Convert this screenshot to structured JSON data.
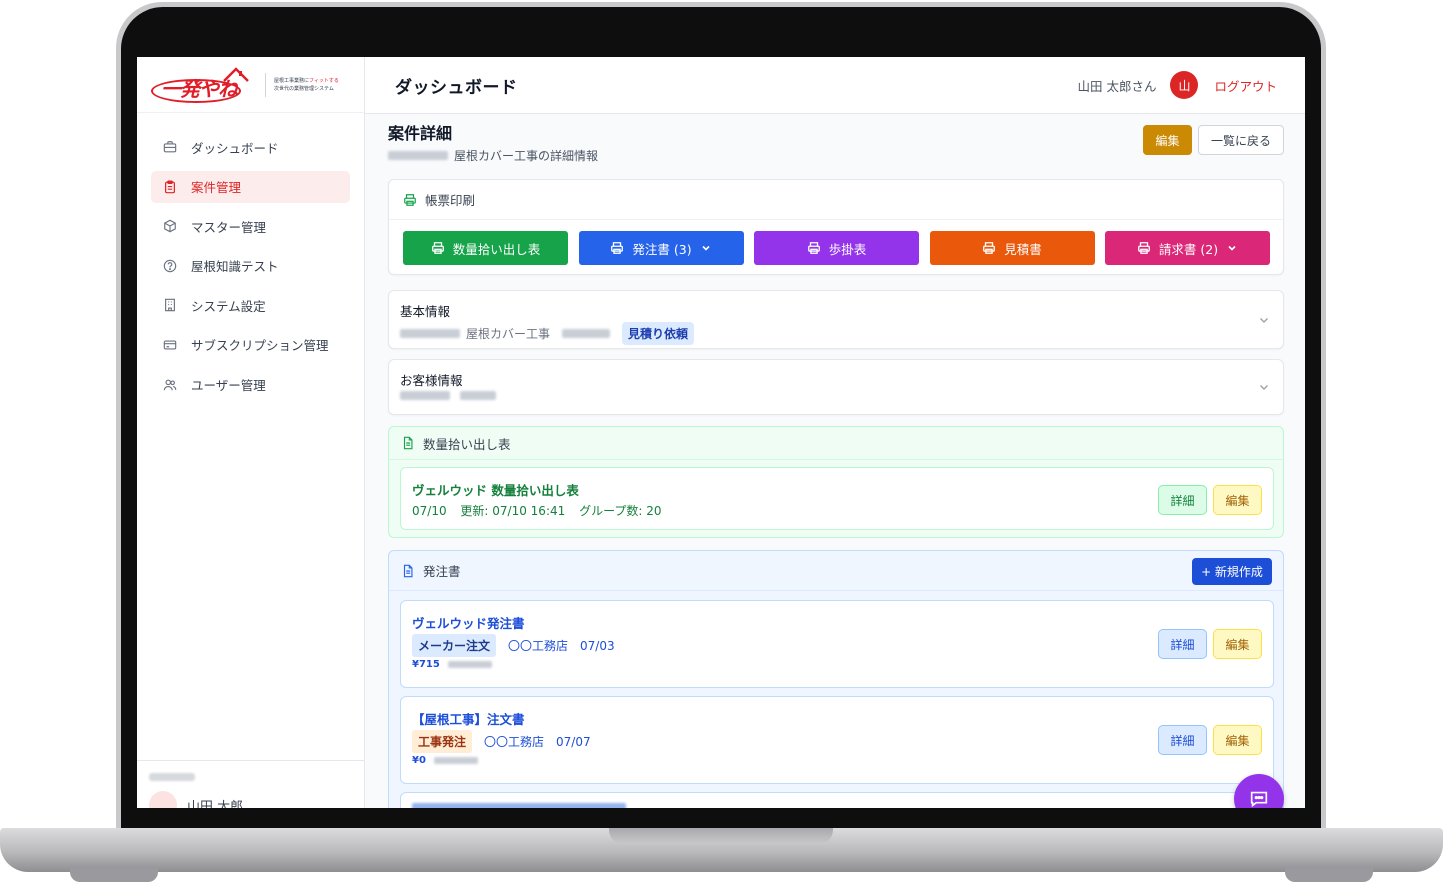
{
  "app": {
    "logo_text": "一発やね",
    "tagline_1": "屋根工事業務に",
    "tagline_hl": "フィットする",
    "tagline_2": "次世代の業務管理システム"
  },
  "header": {
    "page_title": "ダッシュボード",
    "greeting": "山田 太郎さん",
    "avatar_initial": "山",
    "logout_label": "ログアウト"
  },
  "sidebar": {
    "items": [
      {
        "label": "ダッシュボード",
        "icon": "briefcase-icon",
        "active": false
      },
      {
        "label": "案件管理",
        "icon": "clipboard-icon",
        "active": true
      },
      {
        "label": "マスター管理",
        "icon": "cube-icon",
        "active": false
      },
      {
        "label": "屋根知識テスト",
        "icon": "question-circle-icon",
        "active": false
      },
      {
        "label": "システム設定",
        "icon": "building-icon",
        "active": false
      },
      {
        "label": "サブスクリプション管理",
        "icon": "credit-card-icon",
        "active": false
      },
      {
        "label": "ユーザー管理",
        "icon": "users-icon",
        "active": false
      }
    ],
    "footer_user": "山田 太郎"
  },
  "detail": {
    "title": "案件詳細",
    "subtitle": "屋根カバー工事の詳細情報",
    "edit_label": "編集",
    "back_label": "一覧に戻る"
  },
  "print": {
    "title": "帳票印刷",
    "buttons": [
      {
        "label": "数量拾い出し表",
        "color": "#16a34a",
        "dropdown": false
      },
      {
        "label": "発注書 (3)",
        "color": "#2563eb",
        "dropdown": true
      },
      {
        "label": "歩掛表",
        "color": "#9333ea",
        "dropdown": false
      },
      {
        "label": "見積書",
        "color": "#ea580c",
        "dropdown": false
      },
      {
        "label": "請求書 (2)",
        "color": "#db2777",
        "dropdown": true
      }
    ]
  },
  "basic_info": {
    "title": "基本情報",
    "work_type": "屋根カバー工事",
    "status": "見積り依頼"
  },
  "customer_info": {
    "title": "お客様情報"
  },
  "quantity": {
    "section_title": "数量拾い出し表",
    "item_title": "ヴェルウッド 数量拾い出し表",
    "date": "07/10",
    "updated": "更新: 07/10 16:41",
    "groups": "グループ数: 20",
    "detail_label": "詳細",
    "edit_label": "編集"
  },
  "orders": {
    "section_title": "発注書",
    "new_label": "+ 新規作成",
    "items": [
      {
        "title": "ヴェルウッド発注書",
        "tag": "メーカー注文",
        "vendor": "〇〇工務店",
        "date": "07/03",
        "price": "¥715"
      },
      {
        "title": "【屋根工事】注文書",
        "tag": "工事発注",
        "vendor": "〇〇工務店",
        "date": "07/07",
        "price": "¥0"
      }
    ],
    "detail_label": "詳細",
    "edit_label": "編集"
  },
  "colors": {
    "brand": "#dc2626",
    "edit_button": "#ca8a04",
    "chat_button": "#9333ea"
  }
}
